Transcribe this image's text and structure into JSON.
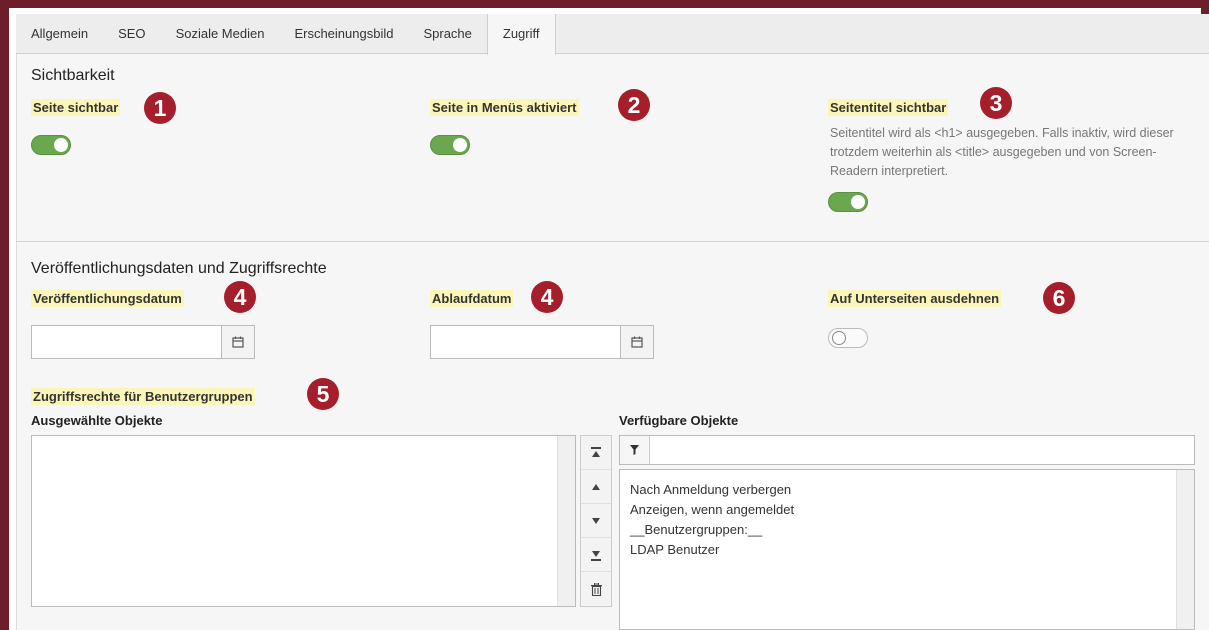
{
  "tabs": [
    {
      "label": "Allgemein",
      "active": false
    },
    {
      "label": "SEO",
      "active": false
    },
    {
      "label": "Soziale Medien",
      "active": false
    },
    {
      "label": "Erscheinungsbild",
      "active": false
    },
    {
      "label": "Sprache",
      "active": false
    },
    {
      "label": "Zugriff",
      "active": true
    }
  ],
  "visibility": {
    "title": "Sichtbarkeit",
    "page_visible": {
      "label": "Seite sichtbar",
      "badge": "1",
      "enabled": true
    },
    "menu_visible": {
      "label": "Seite in Menüs aktiviert",
      "badge": "2",
      "enabled": true
    },
    "title_visible": {
      "label": "Seitentitel sichtbar",
      "badge": "3",
      "enabled": true,
      "help": "Seitentitel wird als <h1> ausgegeben. Falls inaktiv, wird dieser trotzdem weiterhin als <title> ausgegeben und von Screen-Readern interpretiert."
    }
  },
  "access": {
    "title": "Veröffentlichungsdaten und Zugriffsrechte",
    "publish_date": {
      "label": "Veröffentlichungsdatum",
      "badge": "4",
      "value": ""
    },
    "expiry_date": {
      "label": "Ablaufdatum",
      "badge": "4",
      "value": ""
    },
    "extend_subpages": {
      "label": "Auf Unterseiten ausdehnen",
      "badge": "6",
      "enabled": false
    },
    "groups": {
      "label": "Zugriffsrechte für Benutzergruppen",
      "badge": "5",
      "selected_label": "Ausgewählte Objekte",
      "available_label": "Verfügbare Objekte",
      "filter_value": "",
      "available_items": [
        "Nach Anmeldung verbergen",
        "Anzeigen, wenn angemeldet",
        "__Benutzergruppen:__",
        "LDAP Benutzer"
      ]
    }
  },
  "colors": {
    "frame": "#6e1d2a",
    "badge": "#a41e2b",
    "toggle_on": "#6aa84f",
    "highlight": "#faf6b8"
  }
}
